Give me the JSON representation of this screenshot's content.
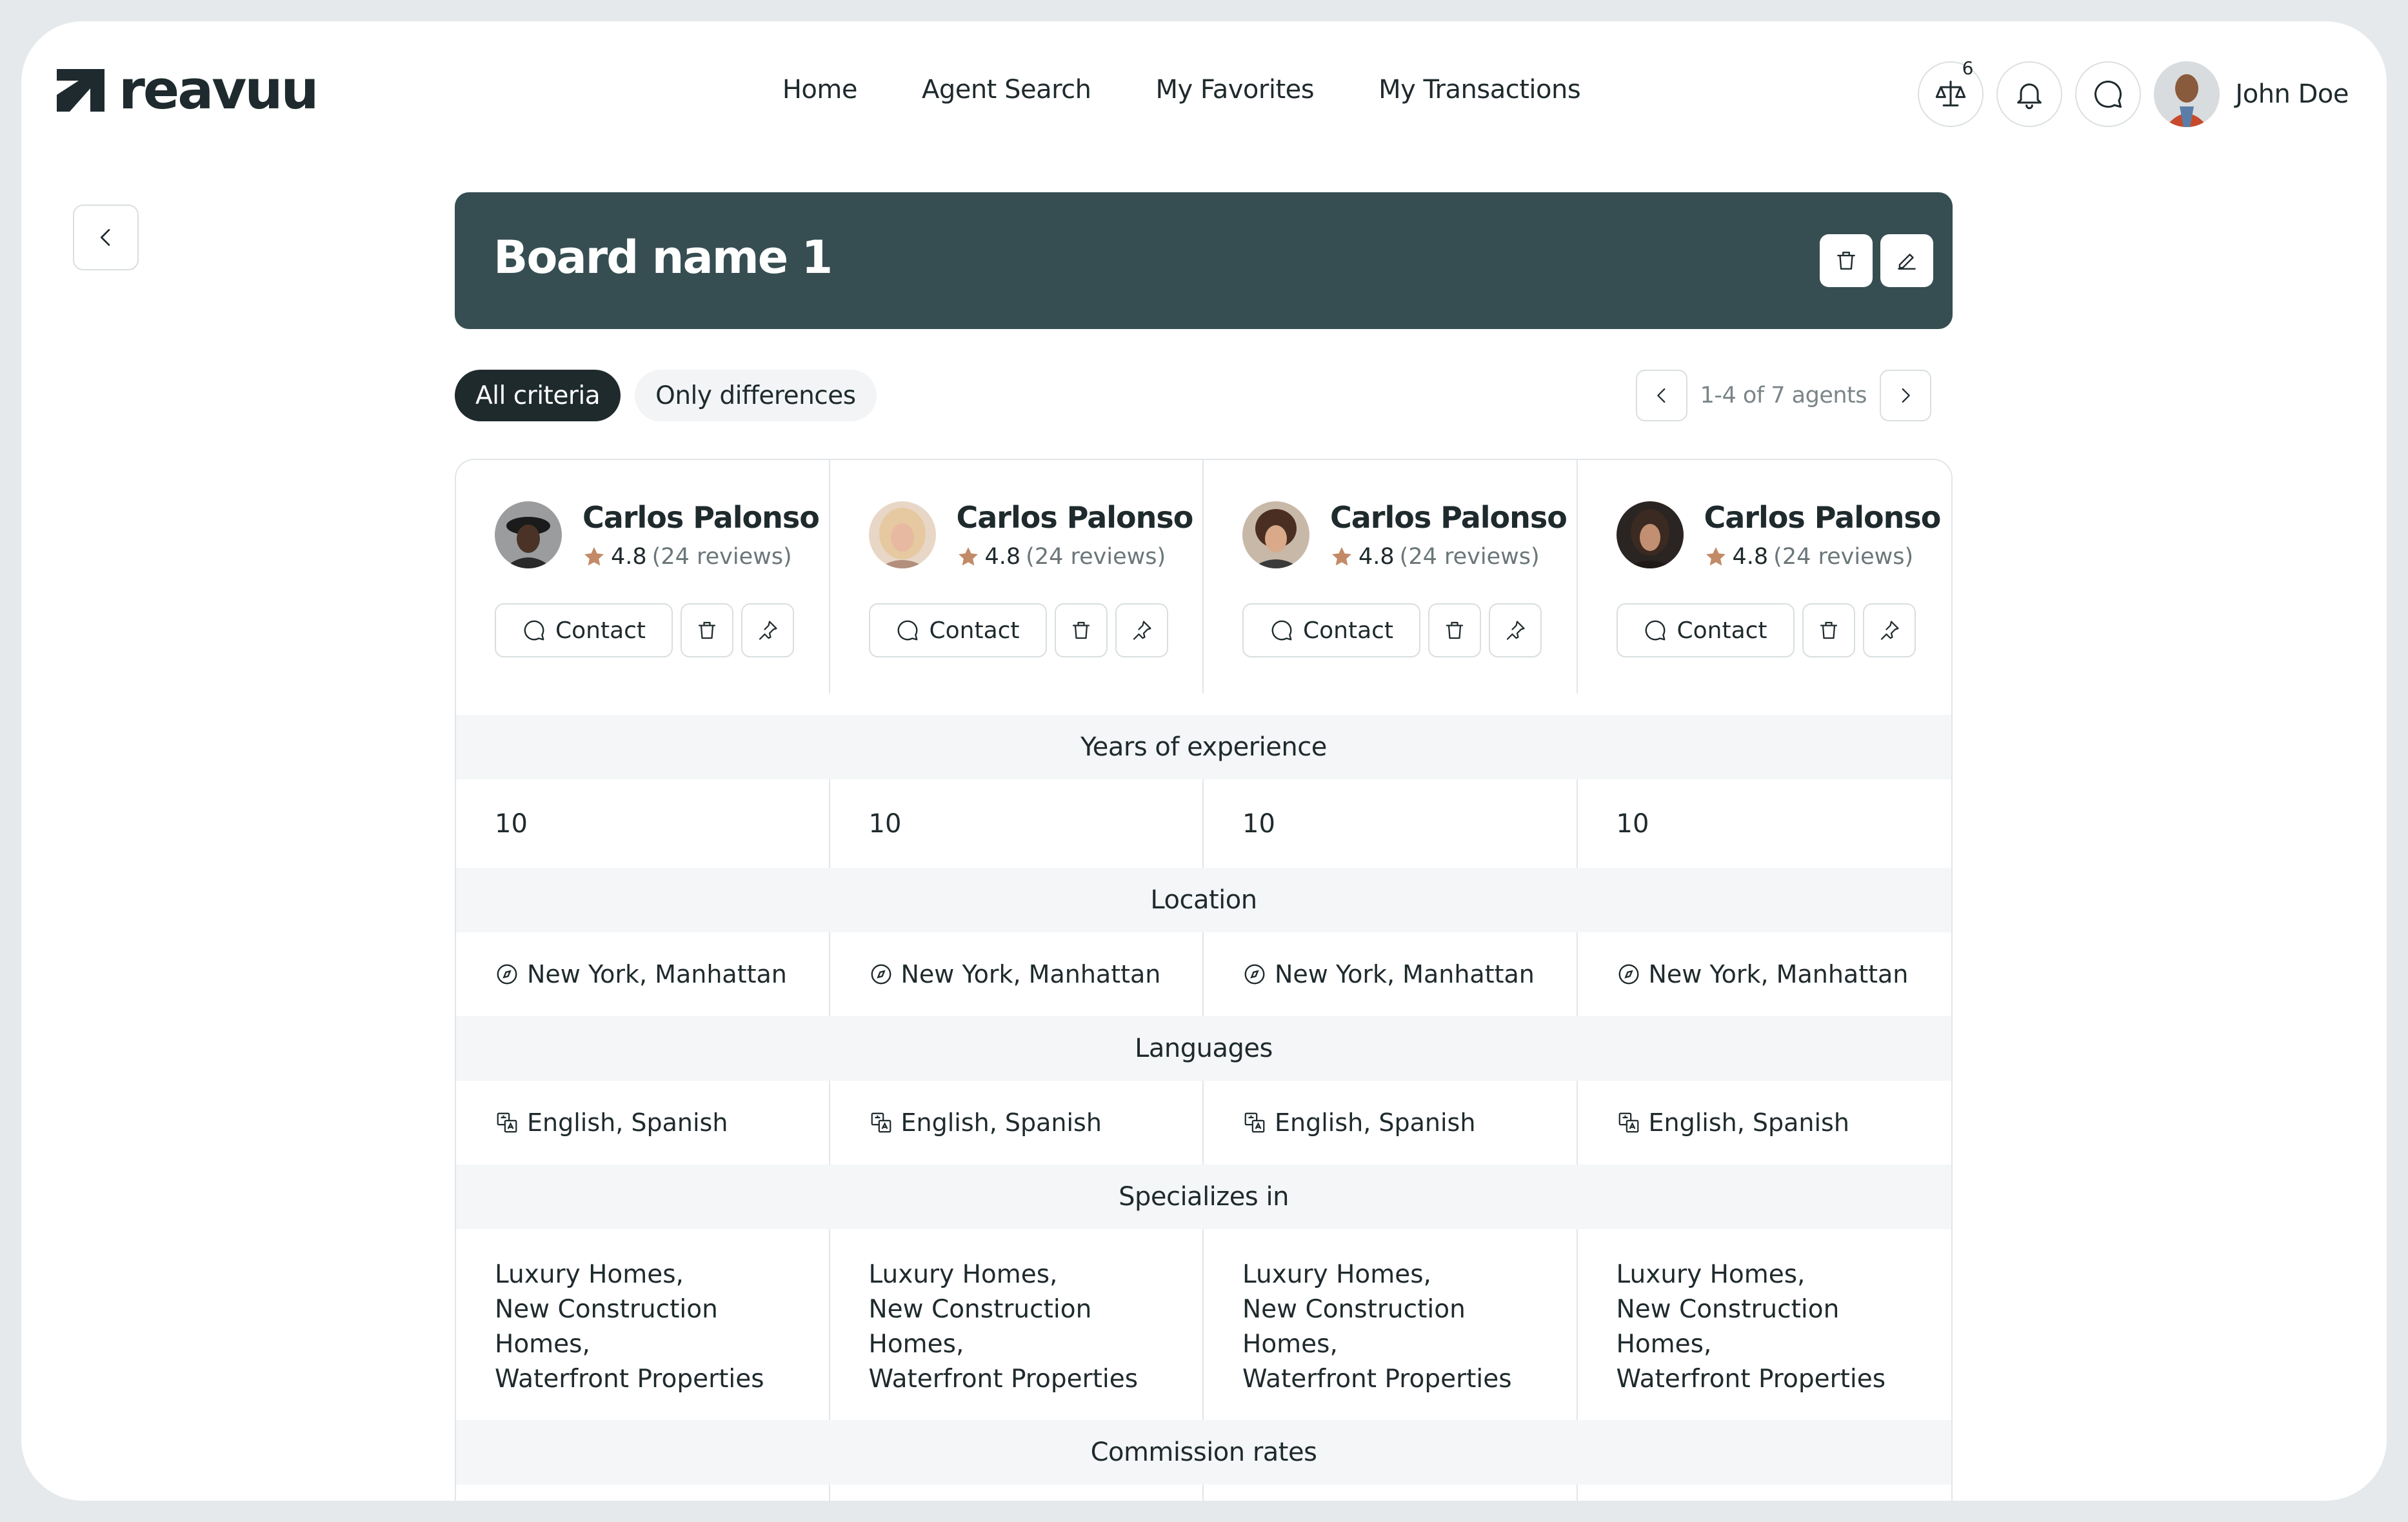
{
  "brand": {
    "name": "reavuu"
  },
  "nav": {
    "items": [
      "Home",
      "Agent Search",
      "My Favorites",
      "My Transactions"
    ]
  },
  "header": {
    "compare_count": "6",
    "user_name": "John Doe"
  },
  "board": {
    "title": "Board name 1"
  },
  "filters": {
    "all": "All criteria",
    "diff": "Only differences"
  },
  "pager": {
    "text": "1-4 of 7 agents"
  },
  "agents": [
    {
      "name": "Carlos Palonso",
      "rating": "4.8",
      "reviews": "(24 reviews)",
      "contact": "Contact"
    },
    {
      "name": "Carlos Palonso",
      "rating": "4.8",
      "reviews": "(24 reviews)",
      "contact": "Contact"
    },
    {
      "name": "Carlos Palonso",
      "rating": "4.8",
      "reviews": "(24 reviews)",
      "contact": "Contact"
    },
    {
      "name": "Carlos Palonso",
      "rating": "4.8",
      "reviews": "(24 reviews)",
      "contact": "Contact"
    }
  ],
  "sections": {
    "experience": {
      "title": "Years of experience",
      "values": [
        "10",
        "10",
        "10",
        "10"
      ]
    },
    "location": {
      "title": "Location",
      "values": [
        "New York, Manhattan",
        "New York, Manhattan",
        "New York, Manhattan",
        "New York, Manhattan"
      ]
    },
    "languages": {
      "title": "Languages",
      "values": [
        "English, Spanish",
        "English, Spanish",
        "English, Spanish",
        "English, Spanish"
      ]
    },
    "specializes": {
      "title": "Specializes in",
      "values": [
        [
          "Luxury Homes,",
          "New Construction",
          "Homes,",
          "Waterfront Properties"
        ],
        [
          "Luxury Homes,",
          "New Construction",
          "Homes,",
          "Waterfront Properties"
        ],
        [
          "Luxury Homes,",
          "New Construction",
          "Homes,",
          "Waterfront Properties"
        ],
        [
          "Luxury Homes,",
          "New Construction",
          "Homes,",
          "Waterfront Properties"
        ]
      ]
    },
    "commission": {
      "title": "Commission rates"
    }
  },
  "colors": {
    "board_bg": "#364e52",
    "star": "#c28a66",
    "chip_active": "#1f2a2d"
  }
}
